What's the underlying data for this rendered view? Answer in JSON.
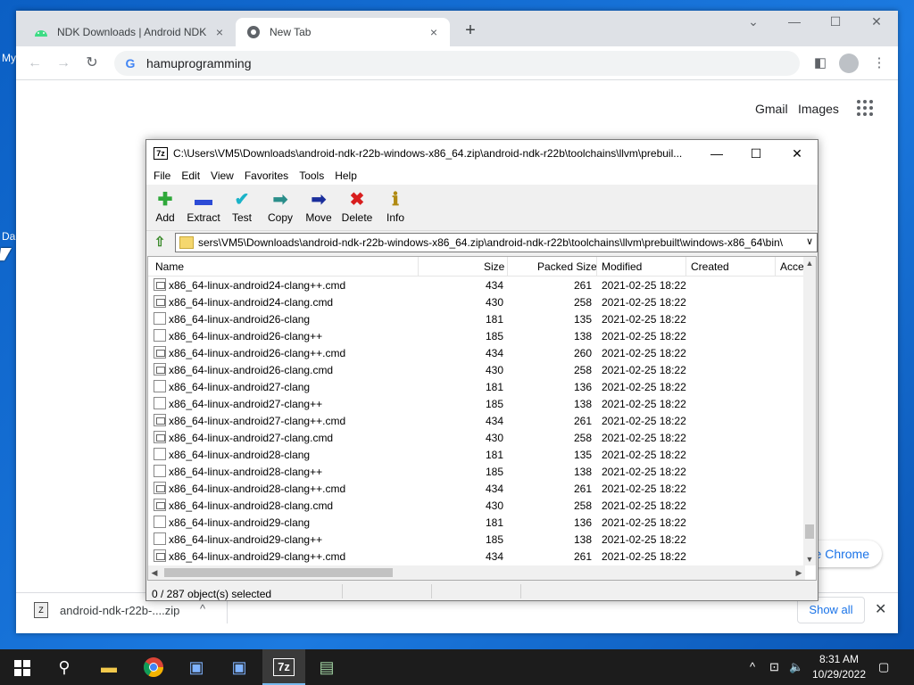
{
  "desktop": {
    "labels": [
      "My",
      "Da"
    ]
  },
  "chrome": {
    "tabs": [
      {
        "title": "NDK Downloads  |  Android NDK",
        "close": "×"
      },
      {
        "title": "New Tab",
        "close": "×"
      }
    ],
    "new_tab": "+",
    "window_controls": {
      "minimize": "—",
      "maximize": "☐",
      "close": "✕",
      "tab_search": "⌄"
    },
    "omnibox": {
      "icon": "G",
      "text": "hamuprogramming"
    },
    "new_tab_page": {
      "gmail": "Gmail",
      "images": "Images",
      "customize": "te Chrome"
    }
  },
  "download_bar": {
    "file_name": "android-ndk-r22b-....zip",
    "icon_text": "Z",
    "show_all": "Show all",
    "close": "✕"
  },
  "sevenzip": {
    "title": "C:\\Users\\VM5\\Downloads\\android-ndk-r22b-windows-x86_64.zip\\android-ndk-r22b\\toolchains\\llvm\\prebuil...",
    "logo": "7z",
    "controls": {
      "minimize": "—",
      "maximize": "☐",
      "close": "✕"
    },
    "menu": [
      "File",
      "Edit",
      "View",
      "Favorites",
      "Tools",
      "Help"
    ],
    "toolbar": [
      {
        "label": "Add",
        "glyph": "✚",
        "color": "#2fa83a"
      },
      {
        "label": "Extract",
        "glyph": "▬",
        "color": "#2c4bd6"
      },
      {
        "label": "Test",
        "glyph": "✔",
        "color": "#1ab3c8"
      },
      {
        "label": "Copy",
        "glyph": "➡",
        "color": "#2a8e8a"
      },
      {
        "label": "Move",
        "glyph": "➡",
        "color": "#1a2e9c"
      },
      {
        "label": "Delete",
        "glyph": "✖",
        "color": "#d81e1e"
      },
      {
        "label": "Info",
        "glyph": "ℹ",
        "color": "#b08a12"
      }
    ],
    "address": "sers\\VM5\\Downloads\\android-ndk-r22b-windows-x86_64.zip\\android-ndk-r22b\\toolchains\\llvm\\prebuilt\\windows-x86_64\\bin\\",
    "columns": [
      "Name",
      "Size",
      "Packed Size",
      "Modified",
      "Created",
      "Acce"
    ],
    "rows": [
      {
        "name": "x86_64-linux-android24-clang++.cmd",
        "size": "434",
        "packed": "261",
        "modified": "2021-02-25 18:22",
        "type": "cmd"
      },
      {
        "name": "x86_64-linux-android24-clang.cmd",
        "size": "430",
        "packed": "258",
        "modified": "2021-02-25 18:22",
        "type": "cmd"
      },
      {
        "name": "x86_64-linux-android26-clang",
        "size": "181",
        "packed": "135",
        "modified": "2021-02-25 18:22",
        "type": "file"
      },
      {
        "name": "x86_64-linux-android26-clang++",
        "size": "185",
        "packed": "138",
        "modified": "2021-02-25 18:22",
        "type": "file"
      },
      {
        "name": "x86_64-linux-android26-clang++.cmd",
        "size": "434",
        "packed": "260",
        "modified": "2021-02-25 18:22",
        "type": "cmd"
      },
      {
        "name": "x86_64-linux-android26-clang.cmd",
        "size": "430",
        "packed": "258",
        "modified": "2021-02-25 18:22",
        "type": "cmd"
      },
      {
        "name": "x86_64-linux-android27-clang",
        "size": "181",
        "packed": "136",
        "modified": "2021-02-25 18:22",
        "type": "file"
      },
      {
        "name": "x86_64-linux-android27-clang++",
        "size": "185",
        "packed": "138",
        "modified": "2021-02-25 18:22",
        "type": "file"
      },
      {
        "name": "x86_64-linux-android27-clang++.cmd",
        "size": "434",
        "packed": "261",
        "modified": "2021-02-25 18:22",
        "type": "cmd"
      },
      {
        "name": "x86_64-linux-android27-clang.cmd",
        "size": "430",
        "packed": "258",
        "modified": "2021-02-25 18:22",
        "type": "cmd"
      },
      {
        "name": "x86_64-linux-android28-clang",
        "size": "181",
        "packed": "135",
        "modified": "2021-02-25 18:22",
        "type": "file"
      },
      {
        "name": "x86_64-linux-android28-clang++",
        "size": "185",
        "packed": "138",
        "modified": "2021-02-25 18:22",
        "type": "file"
      },
      {
        "name": "x86_64-linux-android28-clang++.cmd",
        "size": "434",
        "packed": "261",
        "modified": "2021-02-25 18:22",
        "type": "cmd"
      },
      {
        "name": "x86_64-linux-android28-clang.cmd",
        "size": "430",
        "packed": "258",
        "modified": "2021-02-25 18:22",
        "type": "cmd"
      },
      {
        "name": "x86_64-linux-android29-clang",
        "size": "181",
        "packed": "136",
        "modified": "2021-02-25 18:22",
        "type": "file"
      },
      {
        "name": "x86_64-linux-android29-clang++",
        "size": "185",
        "packed": "138",
        "modified": "2021-02-25 18:22",
        "type": "file"
      },
      {
        "name": "x86_64-linux-android29-clang++.cmd",
        "size": "434",
        "packed": "261",
        "modified": "2021-02-25 18:22",
        "type": "cmd"
      }
    ],
    "status": "0 / 287 object(s) selected"
  },
  "taskbar": {
    "items": [
      "start-icon",
      "search-icon",
      "file-explorer-icon",
      "chrome-icon",
      "network-app-icon",
      "network-app-icon-2",
      "sevenzip-icon",
      "app-window-icon"
    ],
    "tray_glyphs": {
      "chevron": "^",
      "network": "⊡",
      "volume": "🔈",
      "notification": "▢"
    },
    "time": "8:31 AM",
    "date": "10/29/2022"
  }
}
